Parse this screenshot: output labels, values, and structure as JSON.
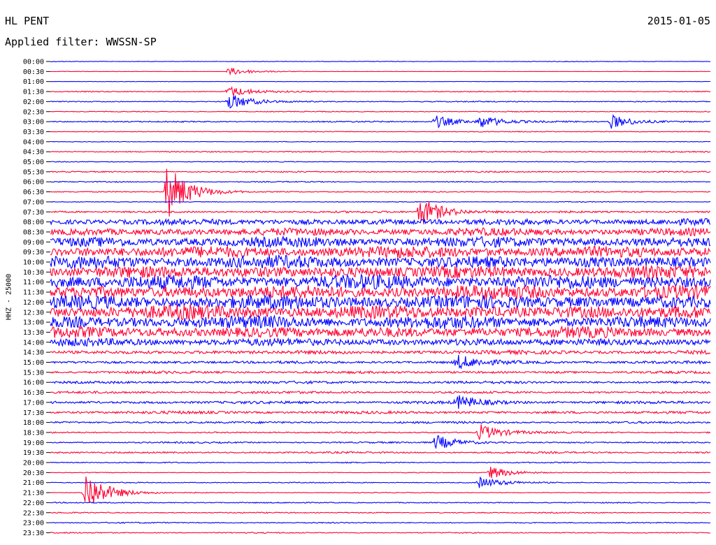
{
  "header": {
    "station": "HL PENT",
    "date": "2015-01-05",
    "filter": "Applied filter: WWSSN-SP"
  },
  "chart_data": {
    "type": "line",
    "title": "HL PENT",
    "ylabel": "HHZ - 25000",
    "row_labels": [
      "00:00",
      "00:30",
      "01:00",
      "01:30",
      "02:00",
      "02:30",
      "03:00",
      "03:30",
      "04:00",
      "04:30",
      "05:00",
      "05:30",
      "06:00",
      "06:30",
      "07:00",
      "07:30",
      "08:00",
      "08:30",
      "09:00",
      "09:30",
      "10:00",
      "10:30",
      "11:00",
      "11:30",
      "12:00",
      "12:30",
      "13:00",
      "13:30",
      "14:00",
      "14:30",
      "15:00",
      "15:30",
      "16:00",
      "16:30",
      "17:00",
      "17:30",
      "18:00",
      "18:30",
      "19:00",
      "19:30",
      "20:00",
      "20:30",
      "21:00",
      "21:30",
      "22:00",
      "22:30",
      "23:00",
      "23:30"
    ],
    "row_minutes": 30,
    "colors": [
      "#0000ff",
      "#ff0033"
    ],
    "noise_level": [
      0.5,
      0.3,
      0.3,
      0.8,
      0.8,
      0.7,
      1.0,
      0.6,
      0.5,
      1.0,
      0.6,
      1.0,
      0.8,
      0.8,
      0.6,
      1.5,
      5,
      6,
      8,
      9,
      10,
      10,
      11,
      11,
      11,
      11,
      10,
      9,
      6,
      3,
      2.2,
      2.0,
      2.0,
      1.8,
      2.2,
      2.2,
      1.6,
      1.2,
      1.2,
      1.4,
      0.9,
      0.6,
      0.8,
      0.6,
      0.9,
      0.9,
      0.9,
      0.9
    ],
    "events": [
      {
        "row": 1,
        "x_min": 8.1,
        "amp": 6
      },
      {
        "row": 3,
        "x_min": 8.1,
        "amp": 8
      },
      {
        "row": 4,
        "x_min": 8.1,
        "amp": 12
      },
      {
        "row": 6,
        "x_min": 17.5,
        "amp": 9
      },
      {
        "row": 6,
        "x_min": 19.5,
        "amp": 9
      },
      {
        "row": 6,
        "x_min": 25.5,
        "amp": 10
      },
      {
        "row": 13,
        "x_min": 5.3,
        "amp": 40
      },
      {
        "row": 15,
        "x_min": 16.8,
        "amp": 22
      },
      {
        "row": 30,
        "x_min": 18.5,
        "amp": 10
      },
      {
        "row": 34,
        "x_min": 18.5,
        "amp": 9
      },
      {
        "row": 37,
        "x_min": 19.5,
        "amp": 12
      },
      {
        "row": 38,
        "x_min": 17.5,
        "amp": 11
      },
      {
        "row": 41,
        "x_min": 20.0,
        "amp": 9
      },
      {
        "row": 42,
        "x_min": 19.5,
        "amp": 8
      },
      {
        "row": 43,
        "x_min": 1.6,
        "amp": 30
      }
    ]
  }
}
